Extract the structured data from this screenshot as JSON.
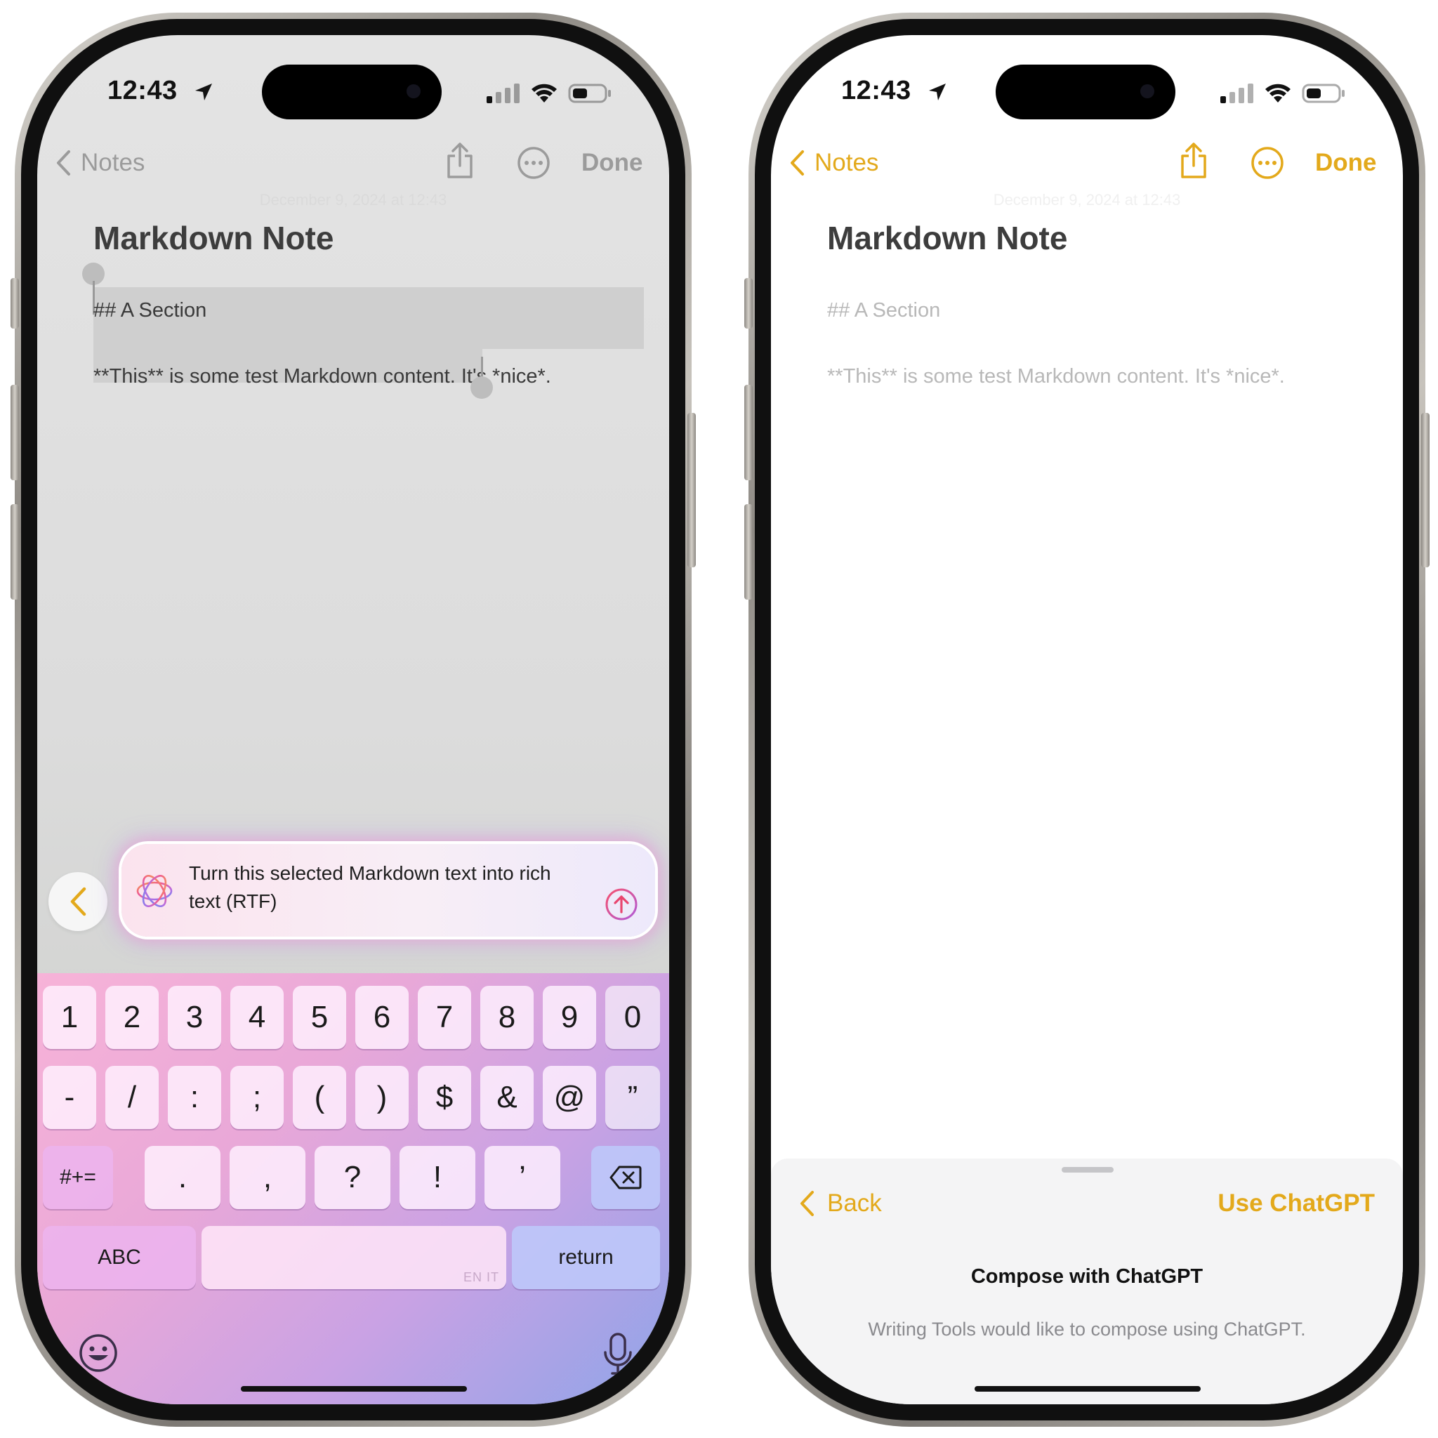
{
  "status": {
    "time": "12:43"
  },
  "left": {
    "nav": {
      "back_label": "Notes",
      "done_label": "Done"
    },
    "note": {
      "date": "December 9, 2024 at 12:43",
      "title": "Markdown Note",
      "line1": "## A Section",
      "line2": "**This** is some test Markdown content. It's *nice*."
    },
    "prompt": {
      "text": "Turn this selected Markdown text into rich text (RTF)"
    },
    "keyboard": {
      "row1": [
        "1",
        "2",
        "3",
        "4",
        "5",
        "6",
        "7",
        "8",
        "9",
        "0"
      ],
      "row2": [
        "-",
        "/",
        ":",
        ";",
        "(",
        ")",
        "$",
        "&",
        "@",
        "”"
      ],
      "row3": [
        ".",
        ",",
        "?",
        "!",
        "’"
      ],
      "symbols_key": "#+=",
      "abc_key": "ABC",
      "return_key": "return",
      "space_hint": "EN IT"
    }
  },
  "right": {
    "nav": {
      "back_label": "Notes",
      "done_label": "Done"
    },
    "note": {
      "date": "December 9, 2024 at 12:43",
      "title": "Markdown Note",
      "line1": "## A Section",
      "line2": "**This** is some test Markdown content. It's *nice*."
    },
    "sheet": {
      "back_label": "Back",
      "use_label": "Use ChatGPT",
      "title": "Compose with ChatGPT",
      "subtitle": "Writing Tools would like to compose using ChatGPT."
    }
  },
  "colors": {
    "accent": "#e3a91b",
    "dimmed": "#9b9b9b"
  }
}
